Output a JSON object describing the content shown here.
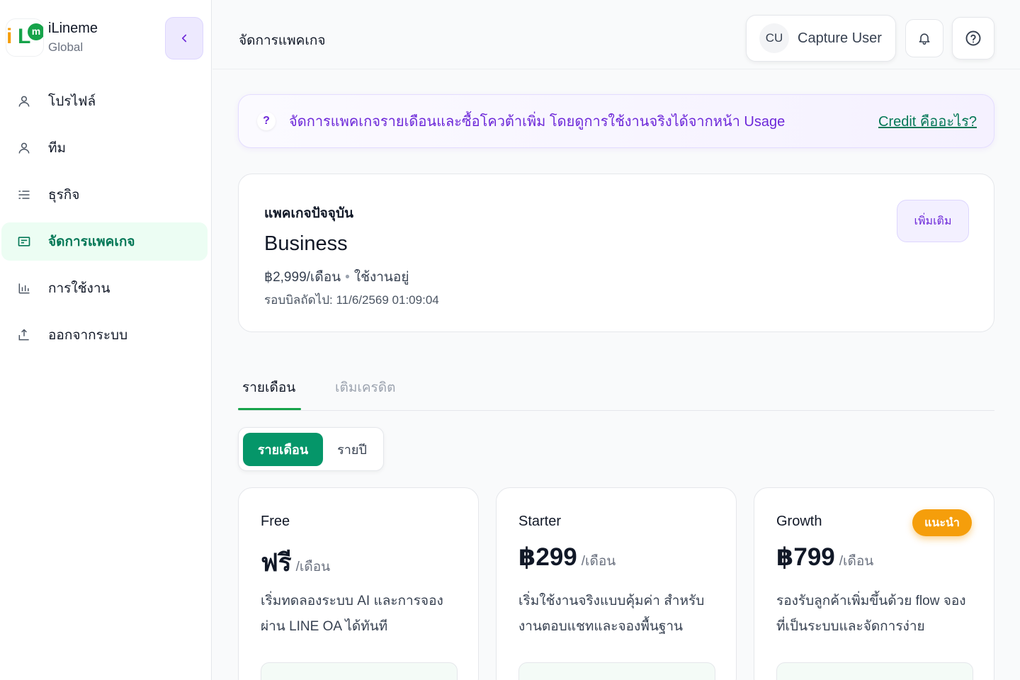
{
  "brand": {
    "name": "iLineme",
    "subtitle": "Global",
    "logo_letters": {
      "i": "i",
      "l": "L",
      "m": "m"
    }
  },
  "sidebar": {
    "items": [
      {
        "label": "โปรไฟล์",
        "icon": "user-icon",
        "active": false
      },
      {
        "label": "ทีม",
        "icon": "user-icon",
        "active": false
      },
      {
        "label": "ธุรกิจ",
        "icon": "list-icon",
        "active": false
      },
      {
        "label": "จัดการแพคเกจ",
        "icon": "card-icon",
        "active": true
      },
      {
        "label": "การใช้งาน",
        "icon": "bar-chart-icon",
        "active": false
      },
      {
        "label": "ออกจากระบบ",
        "icon": "logout-icon",
        "active": false
      }
    ]
  },
  "header": {
    "title": "จัดการแพคเกจ",
    "user": {
      "initials": "CU",
      "name": "Capture User"
    }
  },
  "banner": {
    "icon_text": "?",
    "text": "จัดการแพคเกจรายเดือนและซื้อโควต้าเพิ่ม โดยดูการใช้งานจริงได้จากหน้า Usage",
    "link": "Credit คืออะไร?"
  },
  "current_package": {
    "label": "แพคเกจปัจจุบัน",
    "plan": "Business",
    "price": "฿2,999/เดือน",
    "status": "ใช้งานอยู่",
    "separator": "•",
    "renewal": "รอบบิลถัดไป: 11/6/2569 01:09:04",
    "add_button": "เพิ่มเติม"
  },
  "tabs": {
    "active": "รายเดือน",
    "inactive": "เติมเครดิต"
  },
  "billing_toggle": {
    "monthly": "รายเดือน",
    "yearly": "รายปี"
  },
  "plans": [
    {
      "name": "Free",
      "price": "ฟรี",
      "per": "/เดือน",
      "desc": "เริ่มทดลองระบบ AI และการจองผ่าน LINE OA ได้ทันที",
      "badge": ""
    },
    {
      "name": "Starter",
      "price": "฿299",
      "per": "/เดือน",
      "desc": "เริ่มใช้งานจริงแบบคุ้มค่า สำหรับงานตอบแชทและจองพื้นฐาน",
      "badge": ""
    },
    {
      "name": "Growth",
      "price": "฿799",
      "per": "/เดือน",
      "desc": "รองรับลูกค้าเพิ่มขึ้นด้วย flow จองที่เป็นระบบและจัดการง่าย",
      "badge": "แนะนำ"
    }
  ],
  "colors": {
    "accent_green": "#059669",
    "accent_purple": "#6d28d9",
    "badge_orange": "#f59e0b"
  }
}
